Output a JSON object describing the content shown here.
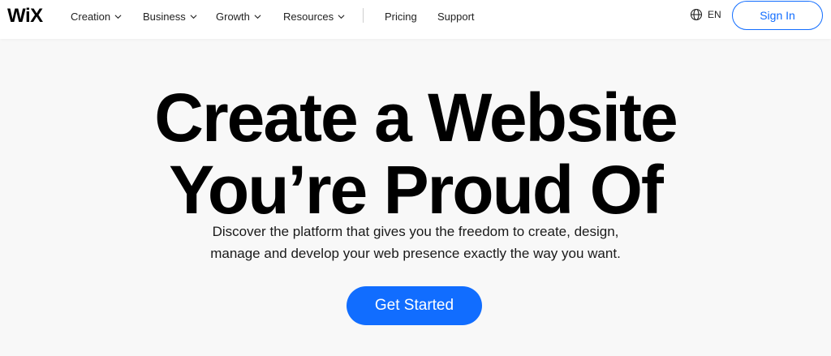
{
  "header": {
    "logo": "WiX",
    "nav": [
      {
        "label": "Creation",
        "has_dropdown": true
      },
      {
        "label": "Business",
        "has_dropdown": true
      },
      {
        "label": "Growth",
        "has_dropdown": true
      },
      {
        "label": "Resources",
        "has_dropdown": true
      },
      {
        "label": "Pricing",
        "has_dropdown": false
      },
      {
        "label": "Support",
        "has_dropdown": false
      }
    ],
    "language": "EN",
    "language_icon": "globe-icon",
    "sign_in": "Sign In"
  },
  "hero": {
    "title_line1": "Create a Website",
    "title_line2": "You’re Proud Of",
    "subtitle_line1": "Discover the platform that gives you the freedom to create, design,",
    "subtitle_line2": "manage and develop your web presence exactly the way you want.",
    "cta": "Get Started"
  },
  "colors": {
    "accent": "#116dff",
    "background": "#f8f8f8",
    "header_bg": "#ffffff"
  }
}
